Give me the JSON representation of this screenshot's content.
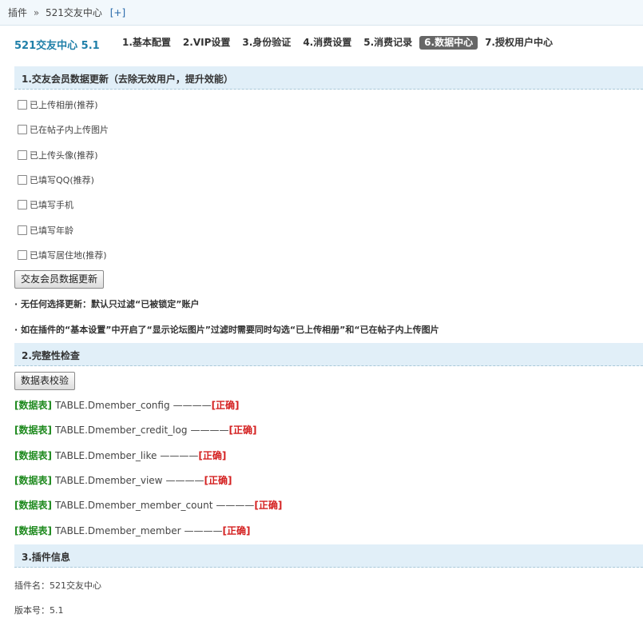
{
  "breadcrumb": {
    "root": "插件",
    "separator": "»",
    "current": "521交友中心",
    "expand": "[+]"
  },
  "app": {
    "title": "521交友中心 5.1"
  },
  "tabs": [
    {
      "label": "1.基本配置",
      "active": false
    },
    {
      "label": "2.VIP设置",
      "active": false
    },
    {
      "label": "3.身份验证",
      "active": false
    },
    {
      "label": "4.消费设置",
      "active": false
    },
    {
      "label": "5.消费记录",
      "active": false
    },
    {
      "label": "6.数据中心",
      "active": true
    },
    {
      "label": "7.授权用户中心",
      "active": false
    }
  ],
  "section1": {
    "title": "1.交友会员数据更新（去除无效用户，提升效能）",
    "options": [
      {
        "label": "已上传相册(推荐)",
        "checked": false
      },
      {
        "label": "已在帖子内上传图片",
        "checked": false
      },
      {
        "label": "已上传头像(推荐)",
        "checked": false
      },
      {
        "label": "已填写QQ(推荐)",
        "checked": false
      },
      {
        "label": "已填写手机",
        "checked": false
      },
      {
        "label": "已填写年龄",
        "checked": false
      },
      {
        "label": "已填写居住地(推荐)",
        "checked": false
      }
    ],
    "button": "交友会员数据更新",
    "notes": [
      "· 无任何选择更新：默认只过滤“已被锁定”账户",
      "· 如在插件的“基本设置”中开启了“显示论坛图片”过滤时需要同时勾选“已上传相册”和“已在帖子内上传图片"
    ]
  },
  "section2": {
    "title": "2.完整性检查",
    "button": "数据表校验",
    "tag": "[数据表]",
    "dashes": "————",
    "tables": [
      {
        "name": "TABLE.Dmember_config",
        "status": "[正确]"
      },
      {
        "name": "TABLE.Dmember_credit_log",
        "status": "[正确]"
      },
      {
        "name": "TABLE.Dmember_like",
        "status": "[正确]"
      },
      {
        "name": "TABLE.Dmember_view",
        "status": "[正确]"
      },
      {
        "name": "TABLE.Dmember_member_count",
        "status": "[正确]"
      },
      {
        "name": "TABLE.Dmember_member",
        "status": "[正确]"
      }
    ]
  },
  "section3": {
    "title": "3.插件信息",
    "plugin_name": "插件名：521交友中心",
    "version": "版本号：5.1"
  }
}
